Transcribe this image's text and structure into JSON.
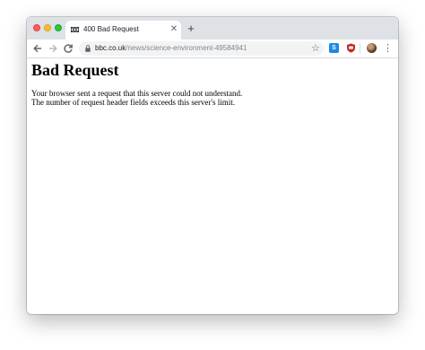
{
  "browser": {
    "tab": {
      "title": "400 Bad Request"
    },
    "omnibox": {
      "url_host": "bbc.co.uk",
      "url_path": "/news/science-environment-49584941"
    },
    "icons": {
      "back": "back-arrow-icon",
      "forward": "forward-arrow-icon",
      "reload": "reload-icon",
      "lock": "lock-icon",
      "bookmark": "star-icon",
      "menu": "kebab-menu-icon"
    },
    "colors": {
      "tabstrip": "#dee1e6",
      "omnibox": "#f1f3f4",
      "traffic_close": "#fe5f57",
      "traffic_minimize": "#febc2e",
      "traffic_maximize": "#28c840"
    }
  },
  "page": {
    "title": "Bad Request",
    "line1": "Your browser sent a request that this server could not understand.",
    "line2": "The number of request header fields exceeds this server's limit."
  }
}
